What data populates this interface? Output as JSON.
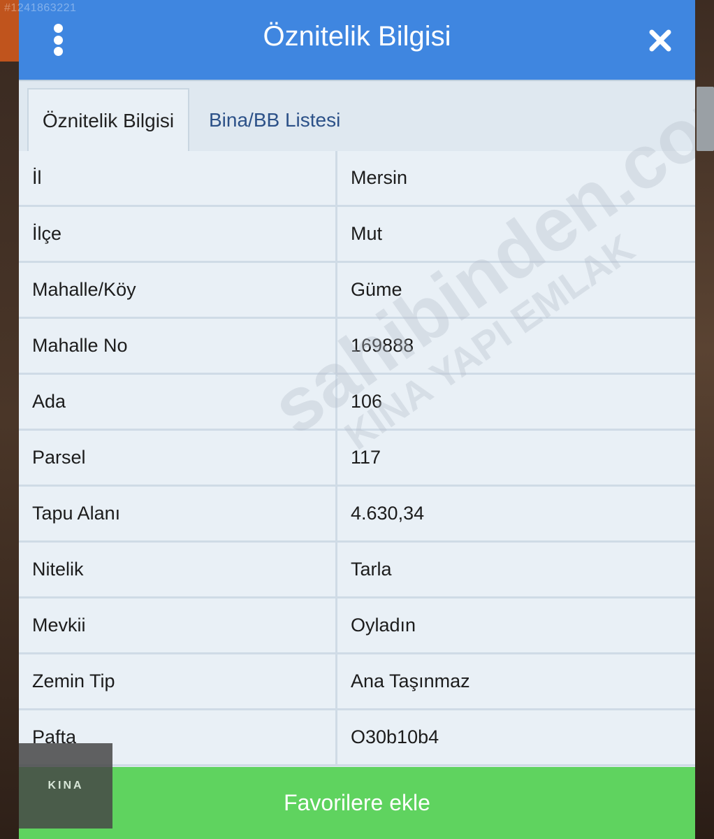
{
  "listing_id": "#1241863221",
  "header": {
    "title": "Öznitelik Bilgisi",
    "menu_icon": "vertical-dots-icon",
    "close_icon": "close-icon"
  },
  "tabs": [
    {
      "label": "Öznitelik Bilgisi",
      "active": true
    },
    {
      "label": "Bina/BB Listesi",
      "active": false
    }
  ],
  "attributes": [
    {
      "key": "İl",
      "value": "Mersin"
    },
    {
      "key": "İlçe",
      "value": "Mut"
    },
    {
      "key": "Mahalle/Köy",
      "value": "Güme"
    },
    {
      "key": "Mahalle No",
      "value": "169888"
    },
    {
      "key": "Ada",
      "value": "106"
    },
    {
      "key": "Parsel",
      "value": "117"
    },
    {
      "key": "Tapu Alanı",
      "value": "4.630,34"
    },
    {
      "key": "Nitelik",
      "value": "Tarla"
    },
    {
      "key": "Mevkii",
      "value": "Oyladın"
    },
    {
      "key": "Zemin Tip",
      "value": "Ana Taşınmaz"
    },
    {
      "key": "Pafta",
      "value": "O30b10b4"
    }
  ],
  "watermark": {
    "line1": "sahibinden.com",
    "line2": "KINA YAPI EMLAK"
  },
  "logo_text": "KINA",
  "footer": {
    "favorite_label": "Favorilere ekle"
  },
  "colors": {
    "header_bg": "#3f86e0",
    "button_bg": "#5fd35f",
    "table_bg": "#e9f0f6"
  }
}
